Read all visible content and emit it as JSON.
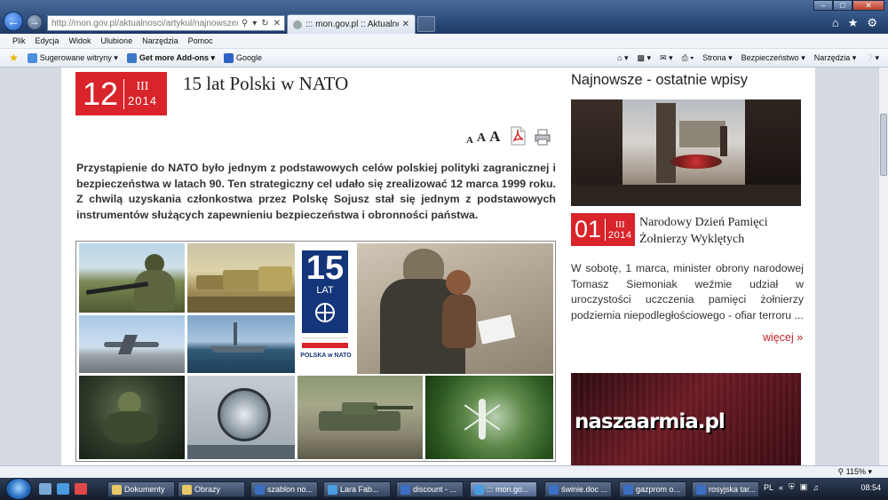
{
  "browser": {
    "address": "http://mon.gov.pl/aktualnosci/artykul/najnowsze/...",
    "tab_title": "::: mon.gov.pl :: Aktualnoś...",
    "menu": [
      "Plik",
      "Edycja",
      "Widok",
      "Ulubione",
      "Narzędzia",
      "Pomoc"
    ],
    "favorites": [
      "Sugerowane witryny ▾",
      "Get more Add-ons ▾",
      "Google"
    ],
    "command_bar": [
      "Strona ▾",
      "Bezpieczeństwo ▾",
      "Narzędzia ▾"
    ],
    "zoom": "115%",
    "icons": [
      "back-arrow-icon",
      "forward-arrow-icon",
      "home-icon",
      "star-icon",
      "gear-icon"
    ]
  },
  "article": {
    "date": {
      "day": "12",
      "month": "III",
      "year": "2014"
    },
    "title": "15 lat Polski w NATO",
    "font_sizes": [
      "A",
      "A",
      "A"
    ],
    "lead": "Przystąpienie do NATO było jednym z podstawowych celów polskiej polityki zagranicznej i bezpieczeństwa w latach 90. Ten strategiczny cel udało się zrealizować 12 marca 1999 roku. Z chwilą uzyskania członkostwa przez Polskę Sojusz stał się jednym z podstawowych instrumentów służących zapewnieniu bezpieczeństwa i obronności państwa.",
    "poster": {
      "number": "15",
      "word": "LAT",
      "caption": "POLSKA w NATO"
    }
  },
  "sidebar": {
    "heading": "Najnowsze - ostatnie wpisy",
    "news_date": {
      "day": "01",
      "month": "III",
      "year": "2014"
    },
    "news_title": "Narodowy Dzień Pamięci Żołnierzy Wyklętych",
    "news_body": "W sobotę, 1 marca, minister obrony narodowej Tomasz Siemoniak weźmie udział w uroczystości uczczenia pamięci żołnierzy podziemia niepodległościowego - ofiar terroru ...",
    "more": "więcej »",
    "banner": "naszaarmia.pl"
  },
  "taskbar": {
    "buttons": [
      "Dokumenty",
      "Obrazy",
      "szablon no...",
      "Lara Fab...",
      "discount - ...",
      "::: mon.go...",
      "świnie.doc ...",
      "gazprom o...",
      "rosyjska tar..."
    ],
    "lang": "PL",
    "clock": "08:54"
  },
  "colors": {
    "accent": "#d8242a",
    "link": "#c0242a"
  }
}
